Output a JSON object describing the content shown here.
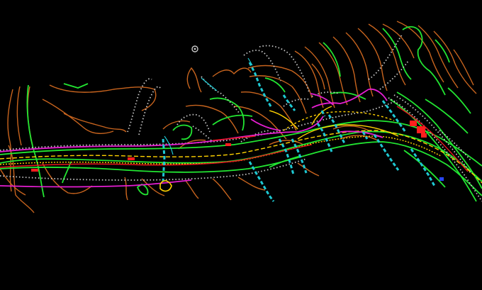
{
  "canvas": {
    "background": "#000000"
  },
  "colors": {
    "contour": "#c8641e",
    "edge": "#22e632",
    "survey": "#c8c8c8",
    "road": "#ffd200",
    "boundary": "#e61ed2",
    "redline": "#e6141e",
    "culvert": "#1ec8d2",
    "marker": "#ff1e1e",
    "blue": "#2846ff"
  },
  "icons": {
    "crosshair": "crosshair-icon"
  }
}
